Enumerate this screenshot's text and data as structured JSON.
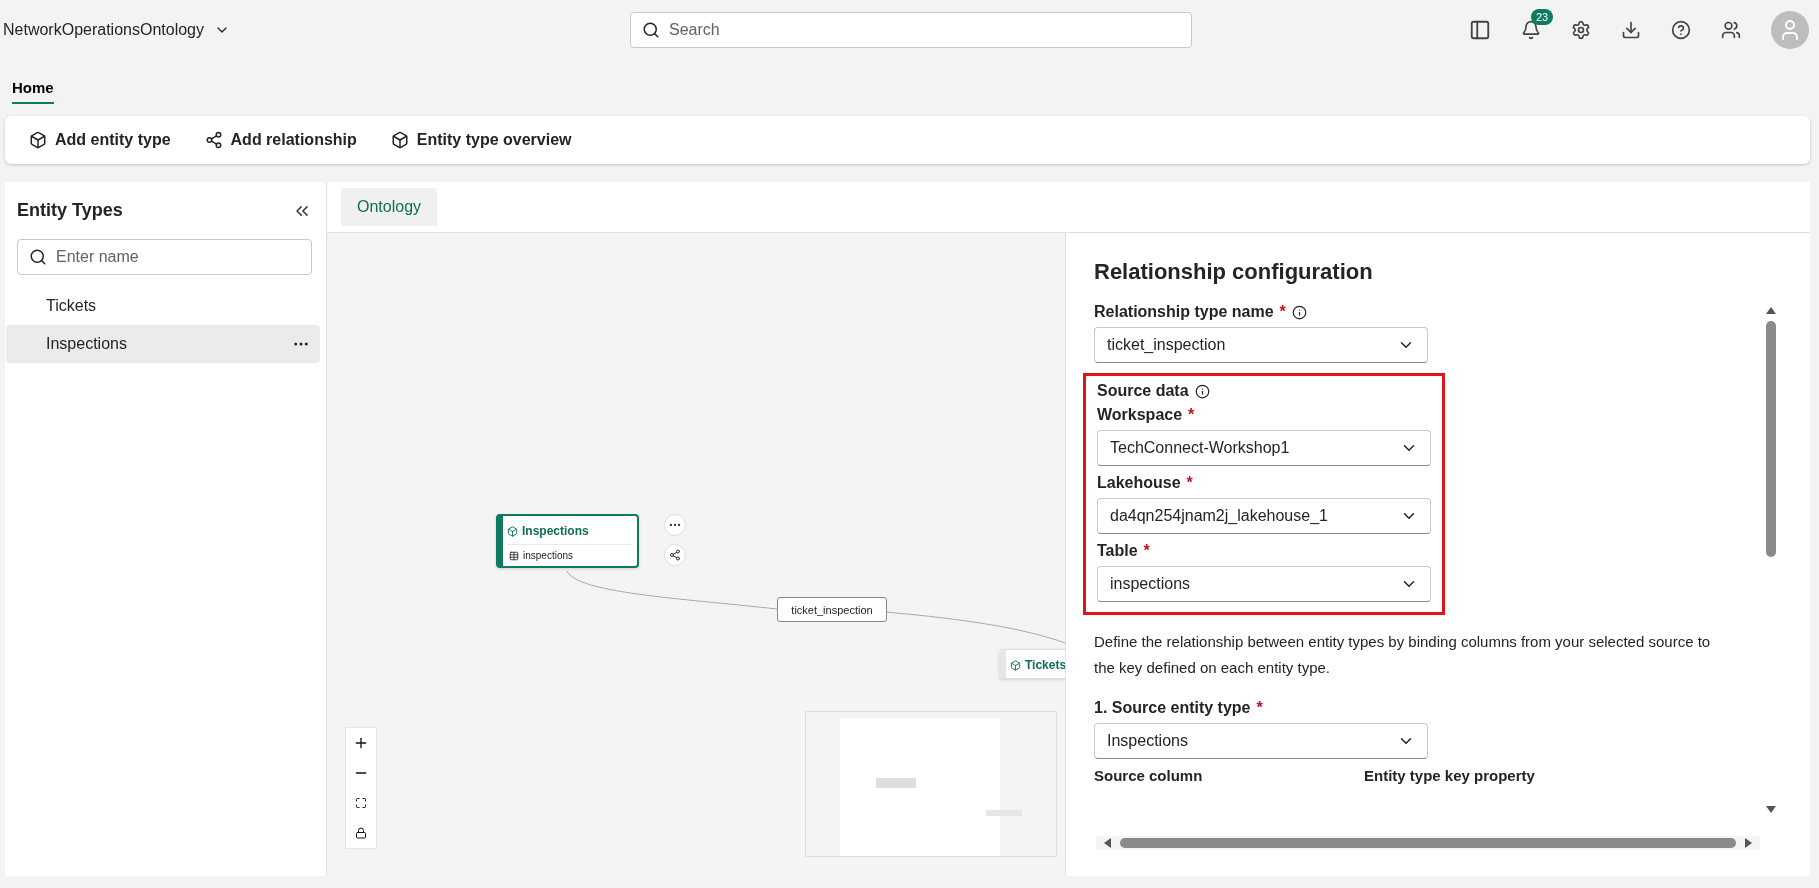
{
  "app": {
    "title": "NetworkOperationsOntology",
    "search": {
      "placeholder": "Search"
    },
    "notifications": "23"
  },
  "ribbon_tabs": [
    {
      "label": "Home",
      "selected": true
    }
  ],
  "toolbar": [
    {
      "label": "Add entity type",
      "kind": "cube"
    },
    {
      "label": "Add relationship",
      "kind": "graph"
    },
    {
      "label": "Entity type overview",
      "kind": "cube"
    }
  ],
  "sidebar": {
    "title": "Entity Types",
    "search": {
      "placeholder": "Enter name"
    },
    "items": [
      {
        "label": "Tickets",
        "selected": false
      },
      {
        "label": "Inspections",
        "selected": true
      }
    ]
  },
  "canvas_tabs": [
    {
      "label": "Ontology",
      "selected": true
    }
  ],
  "canvas": {
    "nodes": [
      {
        "title": "Inspections",
        "table": "inspections",
        "selected": true
      },
      {
        "title": "Tickets",
        "selected": false
      }
    ],
    "edge": {
      "label": "ticket_inspection"
    }
  },
  "panel": {
    "title": "Relationship configuration",
    "relationship_name": {
      "label": "Relationship type name",
      "required_mark": "*",
      "value": "ticket_inspection"
    },
    "source_data": {
      "title": "Source data",
      "highlighted": true,
      "fields": [
        {
          "label": "Workspace",
          "required_mark": "*",
          "value": "TechConnect-Workshop1"
        },
        {
          "label": "Lakehouse",
          "required_mark": "*",
          "value": "da4qn254jnam2j_lakehouse_1"
        },
        {
          "label": "Table",
          "required_mark": "*",
          "value": "inspections"
        }
      ]
    },
    "description": "Define the relationship between entity types by binding columns from your selected source to the key defined on each entity type.",
    "source_entity": {
      "label": "1. Source entity type",
      "required_mark": "*",
      "value": "Inspections"
    },
    "columns": [
      "Source column",
      "Entity type key property"
    ]
  }
}
